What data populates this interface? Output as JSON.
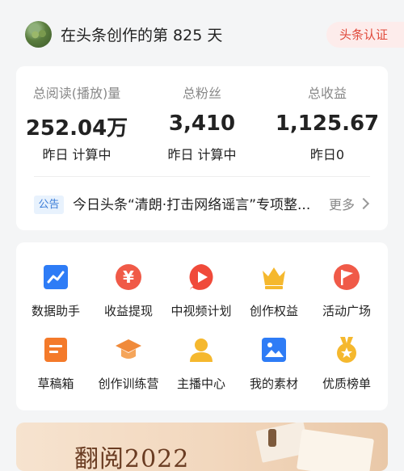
{
  "header": {
    "title": "在头条创作的第 825 天",
    "badge": "头条认证"
  },
  "stats": [
    {
      "label": "总阅读(播放)量",
      "value": "252.04万",
      "sub": "昨日 计算中"
    },
    {
      "label": "总粉丝",
      "value": "3,410",
      "sub": "昨日 计算中"
    },
    {
      "label": "总收益",
      "value": "1,125.67",
      "sub": "昨日0"
    }
  ],
  "notice": {
    "tag": "公告",
    "text": "今日头条“清朗·打击网络谣言”专项整...",
    "more": "更多"
  },
  "tools": [
    {
      "label": "数据助手",
      "icon": "chart-icon",
      "color": "#2e7cf6"
    },
    {
      "label": "收益提现",
      "icon": "yen-icon",
      "color": "#f05a48"
    },
    {
      "label": "中视频计划",
      "icon": "play-icon",
      "color": "#f04a3a"
    },
    {
      "label": "创作权益",
      "icon": "crown-icon",
      "color": "#f5b82e"
    },
    {
      "label": "活动广场",
      "icon": "flag-icon",
      "color": "#f05a48"
    },
    {
      "label": "草稿箱",
      "icon": "draft-icon",
      "color": "#f47a2a"
    },
    {
      "label": "创作训练营",
      "icon": "graduation-cap-icon",
      "color": "#f08a3a"
    },
    {
      "label": "主播中心",
      "icon": "user-icon",
      "color": "#f5b82e"
    },
    {
      "label": "我的素材",
      "icon": "image-icon",
      "color": "#2e7cf6"
    },
    {
      "label": "优质榜单",
      "icon": "medal-icon",
      "color": "#f5b82e"
    }
  ],
  "banner": {
    "text": "翻阅2022"
  }
}
